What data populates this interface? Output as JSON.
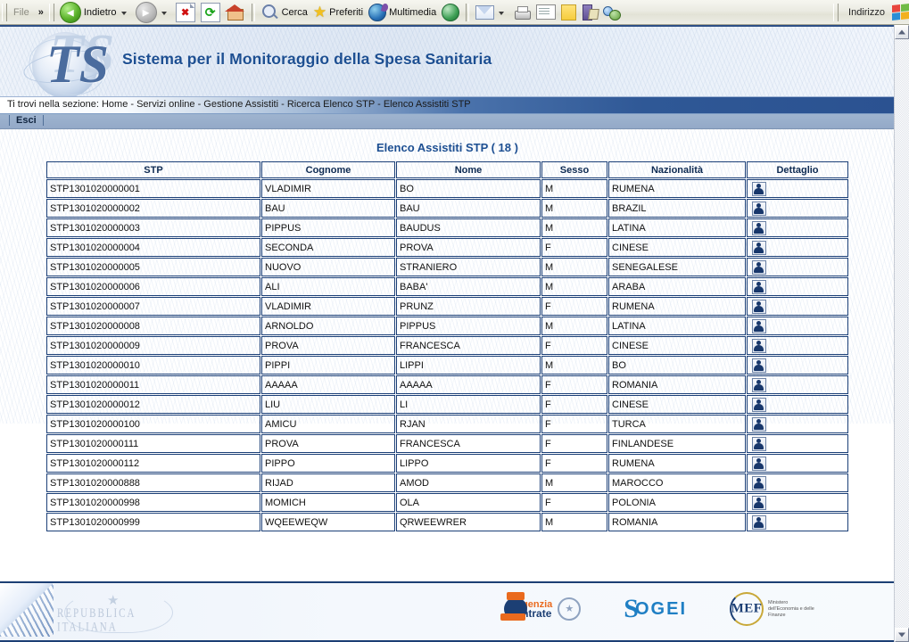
{
  "browser": {
    "file_menu": "File",
    "chevron": "»",
    "address_label": "Indirizzo",
    "buttons": [
      {
        "name": "back-button",
        "label": "Indietro",
        "icon": "back-arrow-icon",
        "has_caret": true
      },
      {
        "name": "forward-button",
        "label": "",
        "icon": "forward-arrow-icon",
        "has_caret": true
      },
      {
        "name": "stop-button",
        "label": "",
        "icon": "stop-icon",
        "has_caret": false
      },
      {
        "name": "refresh-button",
        "label": "",
        "icon": "refresh-icon",
        "has_caret": false
      },
      {
        "name": "home-button",
        "label": "",
        "icon": "home-icon",
        "has_caret": false
      },
      {
        "name": "search-button",
        "label": "Cerca",
        "icon": "search-icon",
        "has_caret": false
      },
      {
        "name": "favorites-button",
        "label": "Preferiti",
        "icon": "star-icon",
        "has_caret": false
      },
      {
        "name": "media-button",
        "label": "Multimedia",
        "icon": "media-globe-icon",
        "has_caret": false
      },
      {
        "name": "history-button",
        "label": "",
        "icon": "history-globe-icon",
        "has_caret": false
      },
      {
        "name": "mail-button",
        "label": "",
        "icon": "mail-icon",
        "has_caret": true
      },
      {
        "name": "print-button",
        "label": "",
        "icon": "printer-icon",
        "has_caret": false
      },
      {
        "name": "edit-button",
        "label": "",
        "icon": "edit-page-icon",
        "has_caret": false
      },
      {
        "name": "notes-button",
        "label": "",
        "icon": "note-icon",
        "has_caret": false
      },
      {
        "name": "research-button",
        "label": "",
        "icon": "research-icon",
        "has_caret": false
      },
      {
        "name": "messenger-button",
        "label": "",
        "icon": "messenger-icon",
        "has_caret": false
      }
    ],
    "windows_flag": "windows-flag-icon"
  },
  "header": {
    "logo_text": "TS",
    "title": "Sistema per il Monitoraggio della Spesa Sanitaria"
  },
  "breadcrumb": {
    "text": "Ti trovi nella sezione: Home - Servizi online - Gestione Assistiti - Ricerca Elenco STP - Elenco Assistiti STP"
  },
  "navbar": {
    "esci": "Esci"
  },
  "main": {
    "list_title": "Elenco Assistiti STP ( 18 )",
    "columns": [
      "STP",
      "Cognome",
      "Nome",
      "Sesso",
      "Nazionalità",
      "Dettaglio"
    ],
    "detail_icon": "person-detail-icon",
    "rows": [
      {
        "stp": "STP1301020000001",
        "cognome": "VLADIMIR",
        "nome": "BO",
        "sesso": "M",
        "nazionalita": "RUMENA"
      },
      {
        "stp": "STP1301020000002",
        "cognome": "BAU",
        "nome": "BAU",
        "sesso": "M",
        "nazionalita": "BRAZIL"
      },
      {
        "stp": "STP1301020000003",
        "cognome": "PIPPUS",
        "nome": "BAUDUS",
        "sesso": "M",
        "nazionalita": "LATINA"
      },
      {
        "stp": "STP1301020000004",
        "cognome": "SECONDA",
        "nome": "PROVA",
        "sesso": "F",
        "nazionalita": "CINESE"
      },
      {
        "stp": "STP1301020000005",
        "cognome": "NUOVO",
        "nome": "STRANIERO",
        "sesso": "M",
        "nazionalita": "SENEGALESE"
      },
      {
        "stp": "STP1301020000006",
        "cognome": "ALI",
        "nome": "BABA'",
        "sesso": "M",
        "nazionalita": "ARABA"
      },
      {
        "stp": "STP1301020000007",
        "cognome": "VLADIMIR",
        "nome": "PRUNZ",
        "sesso": "F",
        "nazionalita": "RUMENA"
      },
      {
        "stp": "STP1301020000008",
        "cognome": "ARNOLDO",
        "nome": "PIPPUS",
        "sesso": "M",
        "nazionalita": "LATINA"
      },
      {
        "stp": "STP1301020000009",
        "cognome": "PROVA",
        "nome": "FRANCESCA",
        "sesso": "F",
        "nazionalita": "CINESE"
      },
      {
        "stp": "STP1301020000010",
        "cognome": "PIPPI",
        "nome": "LIPPI",
        "sesso": "M",
        "nazionalita": "BO"
      },
      {
        "stp": "STP1301020000011",
        "cognome": "AAAAA",
        "nome": "AAAAA",
        "sesso": "F",
        "nazionalita": "ROMANIA"
      },
      {
        "stp": "STP1301020000012",
        "cognome": "LIU",
        "nome": "LI",
        "sesso": "F",
        "nazionalita": "CINESE"
      },
      {
        "stp": "STP1301020000100",
        "cognome": "AMICU",
        "nome": "RJAN",
        "sesso": "F",
        "nazionalita": "TURCA"
      },
      {
        "stp": "STP1301020000111",
        "cognome": "PROVA",
        "nome": "FRANCESCA",
        "sesso": "F",
        "nazionalita": "FINLANDESE"
      },
      {
        "stp": "STP1301020000112",
        "cognome": "PIPPO",
        "nome": "LIPPO",
        "sesso": "F",
        "nazionalita": "RUMENA"
      },
      {
        "stp": "STP1301020000888",
        "cognome": "RIJAD",
        "nome": "AMOD",
        "sesso": "M",
        "nazionalita": "MAROCCO"
      },
      {
        "stp": "STP1301020000998",
        "cognome": "MOMICH",
        "nome": "OLA",
        "sesso": "F",
        "nazionalita": "POLONIA"
      },
      {
        "stp": "STP1301020000999",
        "cognome": "WQEEWEQW",
        "nome": "QRWEEWRER",
        "sesso": "M",
        "nazionalita": "ROMANIA"
      }
    ]
  },
  "footer": {
    "emblem_text": "REPUBBLICA ITALIANA",
    "agenzia": {
      "line1": "genzia",
      "line2": "ntrate"
    },
    "sogei": {
      "s": "S",
      "rest": "OGEI"
    },
    "mef": {
      "acronym": "MEF",
      "subtitle": "Ministero dell'Economia e delle Finanze"
    }
  },
  "colors": {
    "accent_blue": "#1d4f92",
    "table_border": "#1b3f77",
    "breadcrumb_end": "#2b5291",
    "navbar": "#9fb4cf"
  }
}
